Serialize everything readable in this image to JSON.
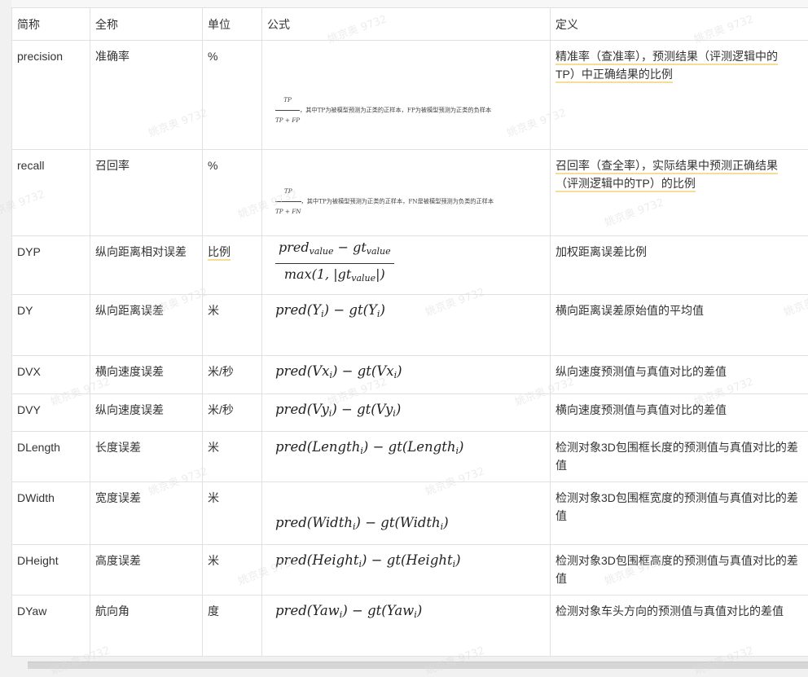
{
  "table": {
    "headers": {
      "short": "简称",
      "full": "全称",
      "unit": "单位",
      "formula": "公式",
      "definition": "定义"
    },
    "precision": {
      "short": "precision",
      "full": "准确率",
      "unit": "%",
      "f_num": "TP",
      "f_den": "TP + FP",
      "f_note": "，其中TP为被模型预测为正类的正样本，FP为被模型预测为正类的负样本",
      "def_line1": "精准率（查准率），预测结果（评测逻辑中的",
      "def_line2": "TP）中正确结果的比例"
    },
    "recall": {
      "short": "recall",
      "full": "召回率",
      "unit": "%",
      "f_num": "TP",
      "f_den": "TP + FN",
      "f_note": "，其中TP为被模型预测为正类的正样本，FN是被模型预测为负类的正样本",
      "def_line1": "召回率（查全率），实际结果中预测正确结果",
      "def_line2": "（评测逻辑中的TP）的比例"
    },
    "dyp": {
      "short": "DYP",
      "full": "纵向距离相对误差",
      "unit": "比例",
      "num_a": "pred",
      "num_a_sub": "value",
      "num_mid": " − gt",
      "num_b_sub": "value",
      "den_a": "max(1, |gt",
      "den_sub": "value",
      "den_end": "|)",
      "definition": "加权距离误差比例"
    },
    "dy": {
      "short": "DY",
      "full": "纵向距离误差",
      "unit": "米",
      "f_pre": "pred(Y",
      "f_sub": "i",
      "f_mid": ") − gt(Y",
      "f_sub2": "i",
      "f_end": ")",
      "definition": "横向距离误差原始值的平均值"
    },
    "dvx": {
      "short": "DVX",
      "full": "横向速度误差",
      "unit": "米/秒",
      "f_pre": "pred(Vx",
      "f_sub": "i",
      "f_mid": ") − gt(Vx",
      "f_sub2": "i",
      "f_end": ")",
      "definition": "纵向速度预测值与真值对比的差值"
    },
    "dvy": {
      "short": "DVY",
      "full": "纵向速度误差",
      "unit": "米/秒",
      "f_pre": "pred(Vy",
      "f_sub": "i",
      "f_mid": ") − gt(Vy",
      "f_sub2": "i",
      "f_end": ")",
      "definition": "横向速度预测值与真值对比的差值"
    },
    "dlength": {
      "short": "DLength",
      "full": "长度误差",
      "unit": "米",
      "f_pre": "pred(Length",
      "f_sub": "i",
      "f_mid": ") − gt(Length",
      "f_sub2": "i",
      "f_end": ")",
      "definition": "检测对象3D包围框长度的预测值与真值对比的差值"
    },
    "dwidth": {
      "short": "DWidth",
      "full": "宽度误差",
      "unit": "米",
      "f_pre": "pred(Width",
      "f_sub": "i",
      "f_mid": ") − gt(Width",
      "f_sub2": "i",
      "f_end": ")",
      "definition": "检测对象3D包围框宽度的预测值与真值对比的差值"
    },
    "dheight": {
      "short": "DHeight",
      "full": "高度误差",
      "unit": "米",
      "f_pre": "pred(Height",
      "f_sub": "i",
      "f_mid": ") − gt(Height",
      "f_sub2": "i",
      "f_end": ")",
      "definition": "检测对象3D包围框高度的预测值与真值对比的差值"
    },
    "dyaw": {
      "short": "DYaw",
      "full": "航向角",
      "unit": "度",
      "f_pre": "pred(Yaw",
      "f_sub": "i",
      "f_mid": ") − gt(Yaw",
      "f_sub2": "i",
      "f_end": ")",
      "definition": "检测对象车头方向的预测值与真值对比的差值"
    }
  },
  "watermark": "姚京奥 9732"
}
